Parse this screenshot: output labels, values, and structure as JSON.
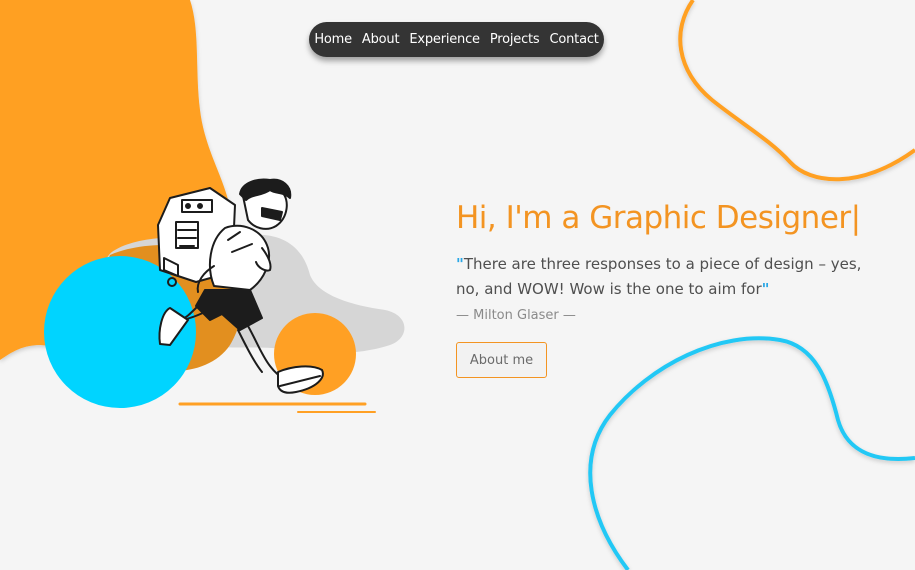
{
  "nav": {
    "items": [
      {
        "label": "Home"
      },
      {
        "label": "About"
      },
      {
        "label": "Experience"
      },
      {
        "label": "Projects"
      },
      {
        "label": "Contact"
      }
    ]
  },
  "hero": {
    "title": "Hi, I'm a Graphic Designer",
    "caret": "|",
    "quote_open": "\"",
    "quote_text": "There are three responses to a piece of design – yes, no, and WOW! Wow is the one to aim for",
    "quote_close": "\"",
    "author": "— Milton Glaser —",
    "button_label": "About me"
  },
  "colors": {
    "accent_orange": "#f39422",
    "accent_blue": "#00d4ff",
    "quote_mark_blue": "#2aa7e6",
    "nav_background": "#343434",
    "page_background": "#f5f5f5"
  },
  "icons": {
    "illustration": "running-boy-with-robot-backpack"
  }
}
